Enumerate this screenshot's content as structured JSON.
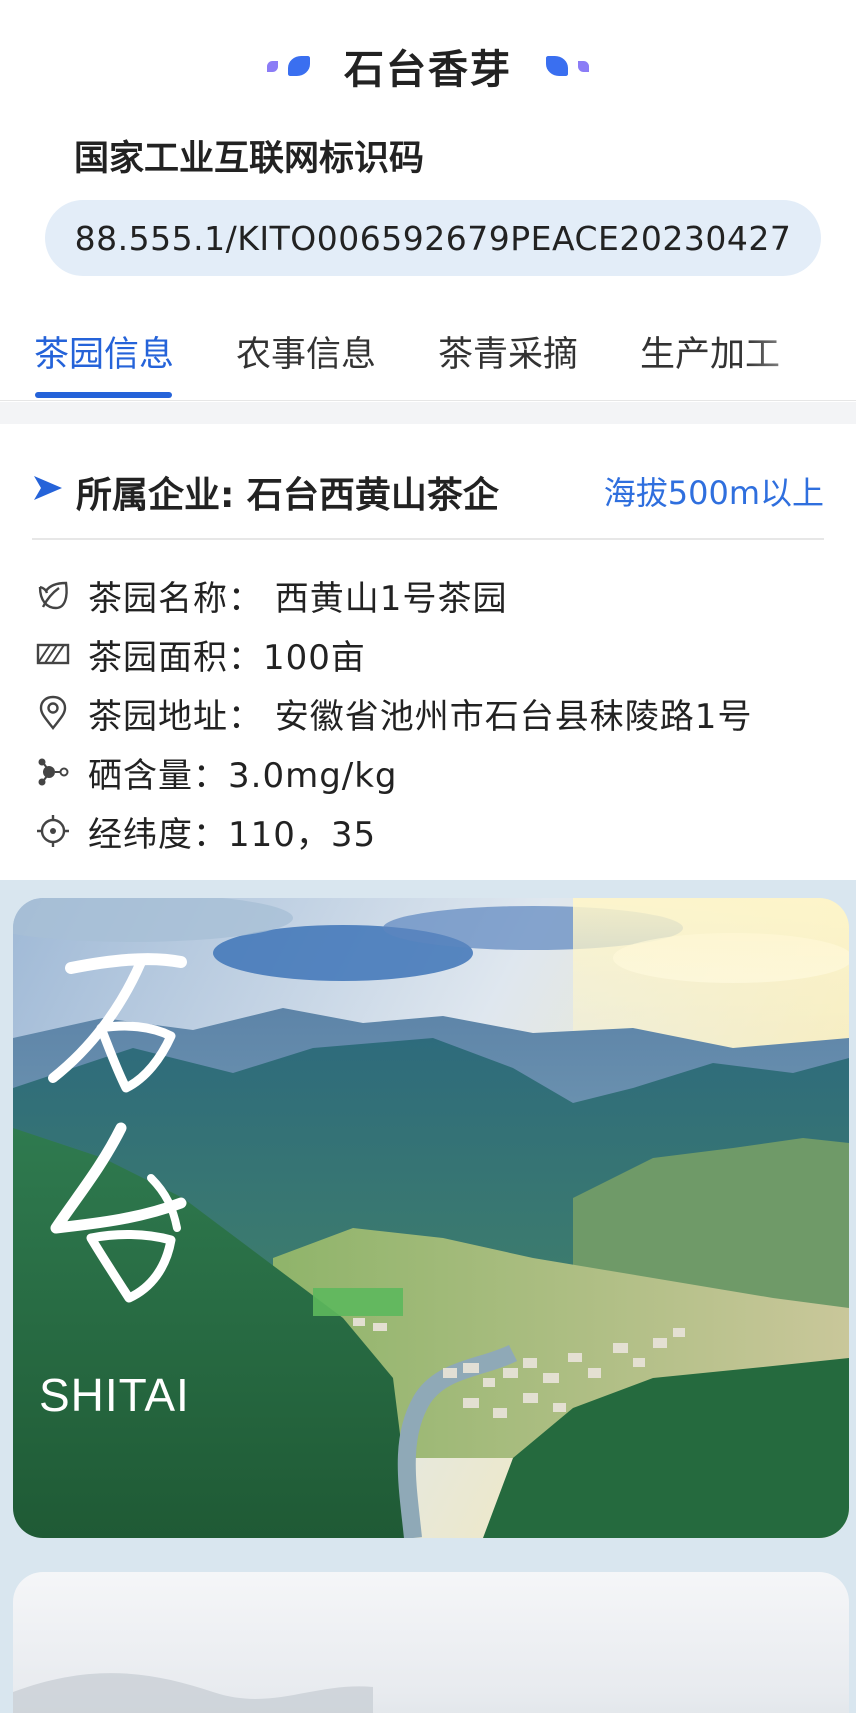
{
  "header": {
    "title": "石台香芽",
    "code_label": "国家工业互联网标识码",
    "code_value": "88.555.1/KITO006592679PEACE20230427"
  },
  "tabs": [
    {
      "label": "茶园信息",
      "active": true
    },
    {
      "label": "农事信息",
      "active": false
    },
    {
      "label": "茶青采摘",
      "active": false
    },
    {
      "label": "生产加工",
      "active": false
    }
  ],
  "info": {
    "company_label": "所属企业: 石台西黄山茶企",
    "altitude": "海拔500m以上",
    "rows": [
      {
        "icon": "leaf-icon",
        "text": "茶园名称：  西黄山1号茶园"
      },
      {
        "icon": "area-icon",
        "text": "茶园面积：100亩"
      },
      {
        "icon": "location-pin-icon",
        "text": "茶园地址：  安徽省池州市石台县秣陵路1号"
      },
      {
        "icon": "molecule-icon",
        "text": "硒含量：3.0mg/kg"
      },
      {
        "icon": "crosshair-icon",
        "text": "经纬度：110，35"
      }
    ]
  },
  "gallery": {
    "photo1_caption": "SHITAI",
    "photo1_calligraphy": "石台"
  },
  "colors": {
    "accent": "#2563d9",
    "altitude_text": "#2f6fde",
    "code_pill_bg": "#e3edf8",
    "gallery_bg": "#d9e6ef"
  }
}
